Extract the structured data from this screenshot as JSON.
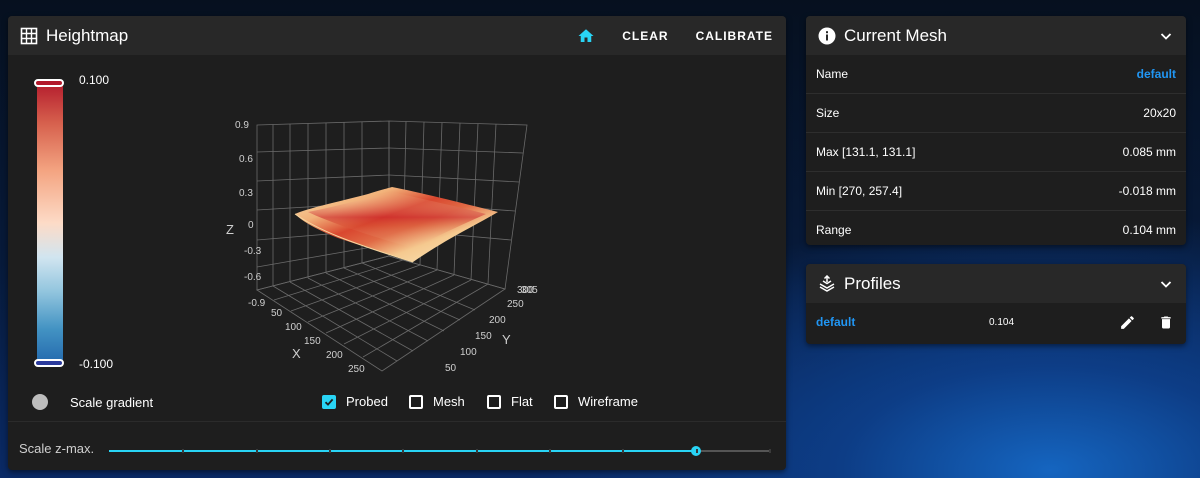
{
  "heightmap": {
    "title": "Heightmap",
    "buttons": {
      "clear": "CLEAR",
      "calibrate": "CALIBRATE"
    },
    "legend": {
      "max": "0.100",
      "min": "-0.100"
    },
    "scale_gradient_label": "Scale gradient",
    "options": [
      {
        "label": "Probed",
        "checked": true
      },
      {
        "label": "Mesh",
        "checked": false
      },
      {
        "label": "Flat",
        "checked": false
      },
      {
        "label": "Wireframe",
        "checked": false
      }
    ],
    "scale_zmax_label": "Scale z-max.",
    "scale_zmax_fraction": 0.89,
    "plot": {
      "z_axis_title": "Z",
      "x_axis_title": "X",
      "y_axis_title": "Y",
      "z_ticks": [
        "0.9",
        "0.6",
        "0.3",
        "0",
        "-0.3",
        "-0.6",
        "-0.9"
      ],
      "x_ticks": [
        "50",
        "100",
        "150",
        "200",
        "250"
      ],
      "y_ticks": [
        "50",
        "100",
        "150",
        "200",
        "250",
        "300"
      ],
      "y_extra_tick": "305"
    },
    "colors": {
      "accent": "#29d4f5",
      "gradient_top": "#b2182b",
      "gradient_bottom": "#2166ac"
    }
  },
  "current_mesh": {
    "title": "Current Mesh",
    "rows": [
      {
        "label": "Name",
        "value": "default"
      },
      {
        "label": "Size",
        "value": "20x20"
      },
      {
        "label": "Max [131.1, 131.1]",
        "value": "0.085 mm"
      },
      {
        "label": "Min [270, 257.4]",
        "value": "-0.018 mm"
      },
      {
        "label": "Range",
        "value": "0.104 mm"
      }
    ]
  },
  "profiles": {
    "title": "Profiles",
    "items": [
      {
        "name": "default",
        "value": "0.104"
      }
    ]
  }
}
